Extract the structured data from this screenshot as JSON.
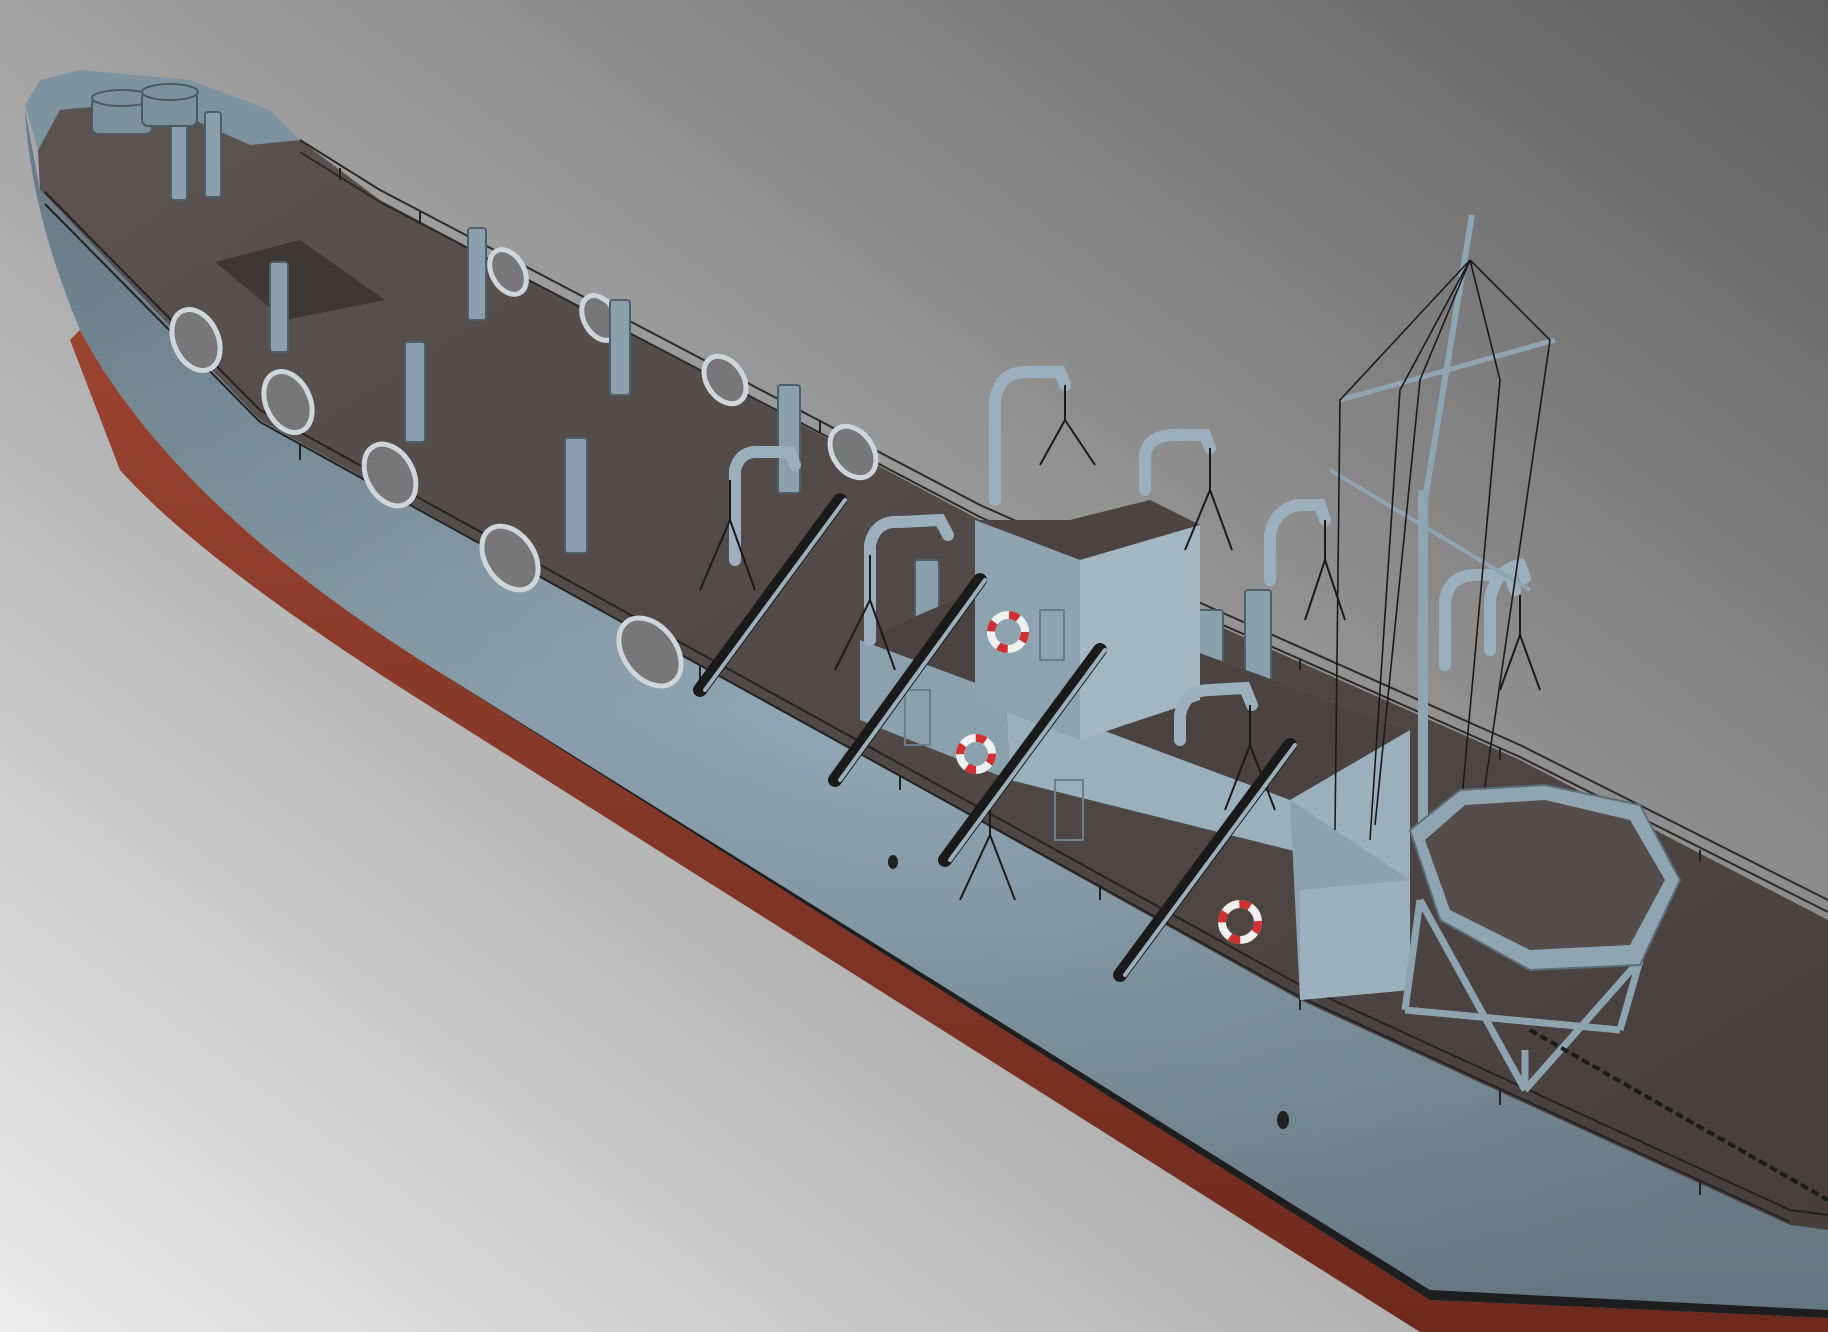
{
  "scene": {
    "subject": "ship-3d-render",
    "colors": {
      "background_top_right": "#6b6b6b",
      "background_bottom_left": "#e6e6e6",
      "hull": "#8ea3b0",
      "hull_dark": "#6f8592",
      "hull_bottom": "#8a3a2a",
      "deck": "#4f4846",
      "deck_light": "#5e5654",
      "metal": "#9fb3c0",
      "lifebuoy_red": "#d03030",
      "lifebuoy_white": "#f2f2f2"
    }
  }
}
